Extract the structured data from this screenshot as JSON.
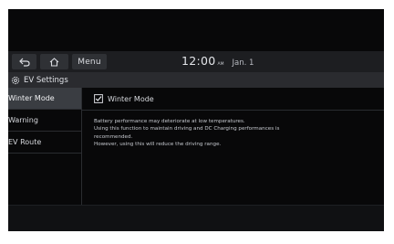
{
  "topbar": {
    "menu_label": "Menu",
    "time": "12:00",
    "ampm": "AM",
    "date": "Jan. 1"
  },
  "title_bar": {
    "title": "EV Settings"
  },
  "sidebar": {
    "items": [
      {
        "label": "Winter Mode",
        "active": true
      },
      {
        "label": "Warning"
      },
      {
        "label": "EV Route"
      }
    ]
  },
  "content": {
    "winter_mode_label": "Winter Mode",
    "winter_mode_checked": true,
    "description": [
      "Battery performance may deteriorate at low temperatures.",
      "Using this function to maintain driving and DC Charging performances is",
      "recommended.",
      "However, using this will reduce the driving range."
    ]
  }
}
